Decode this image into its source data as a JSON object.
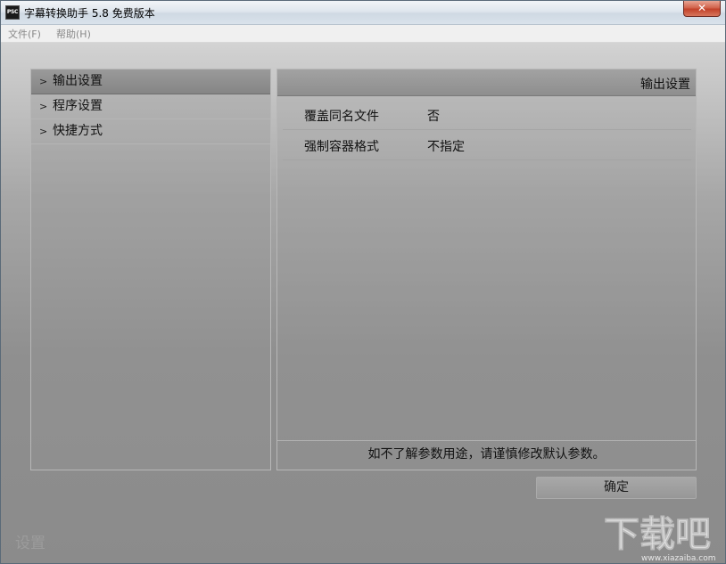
{
  "window": {
    "icon_text": "PSC",
    "title": "字幕转换助手 5.8 免费版本",
    "close_glyph": "✕"
  },
  "menu": [
    {
      "label": "文件(F)"
    },
    {
      "label": "帮助(H)"
    }
  ],
  "nav": {
    "items": [
      {
        "label": "输出设置",
        "active": true
      },
      {
        "label": "程序设置",
        "active": false
      },
      {
        "label": "快捷方式",
        "active": false
      }
    ],
    "chevron": ">"
  },
  "panel": {
    "title": "输出设置",
    "rows": [
      {
        "key": "覆盖同名文件",
        "value": "否"
      },
      {
        "key": "强制容器格式",
        "value": "不指定"
      }
    ],
    "footer_note": "如不了解参数用途，请谨慎修改默认参数。"
  },
  "buttons": {
    "ok_label": "确定"
  },
  "status": {
    "text": "设置"
  },
  "watermark": {
    "text": "下载吧",
    "url": "www.xiazaiba.com"
  },
  "colors": {
    "active_nav": "#8c8c8c",
    "panel_border": "#b7b7b7"
  },
  "icons": [
    "app-icon",
    "close-icon",
    "chevron-right-icon"
  ]
}
